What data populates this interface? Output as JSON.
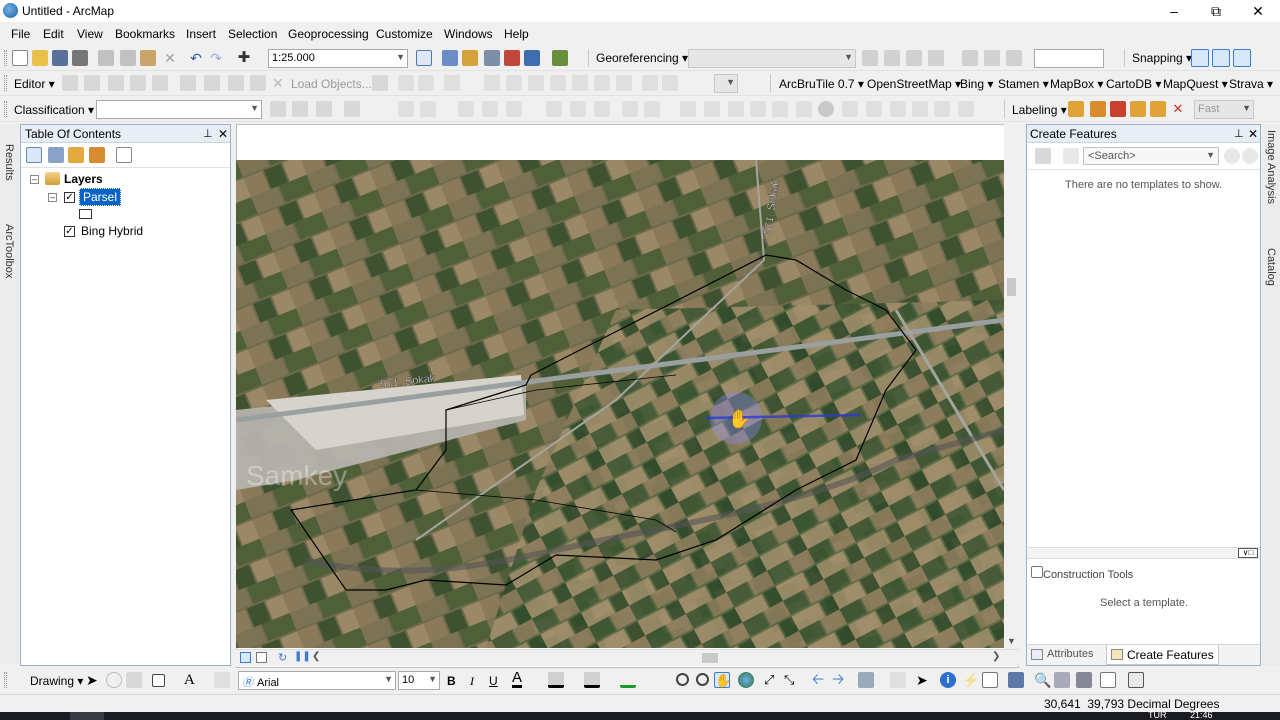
{
  "window": {
    "title": "Untitled - ArcMap"
  },
  "menubar": [
    "File",
    "Edit",
    "View",
    "Bookmarks",
    "Insert",
    "Selection",
    "Geoprocessing",
    "Customize",
    "Windows",
    "Help"
  ],
  "toolbar1": {
    "scale": "1:25.000",
    "georeferencing": "Georeferencing ▾",
    "snapping": "Snapping ▾"
  },
  "toolbar2": {
    "editor": "Editor ▾",
    "load_objects": "Load Objects...",
    "arcbrutile": "ArcBruTile 0.7 ▾",
    "providers": [
      "OpenStreetMap ▾",
      "Bing ▾",
      "Stamen ▾",
      "MapBox ▾",
      "CartoDB ▾",
      "MapQuest ▾",
      "Strava ▾"
    ]
  },
  "toolbar3": {
    "classification": "Classification ▾",
    "labeling": "Labeling ▾",
    "fast": "Fast"
  },
  "toc": {
    "title": "Table Of Contents",
    "root": "Layers",
    "layers": [
      {
        "name": "Parsel"
      },
      {
        "name": "Bing Hybrid"
      }
    ]
  },
  "left_tabs": [
    "Results",
    "ArcToolbox"
  ],
  "right_tabs": [
    "Image Analysis",
    "Catalog"
  ],
  "map_labels": [
    "571. Sokak",
    "571. Sokak",
    "Samkey"
  ],
  "create_features": {
    "title": "Create Features",
    "search_placeholder": "<Search>",
    "empty_message": "There are no templates to show.",
    "construction_title": "Construction Tools",
    "construction_message": "Select a template.",
    "tabs": [
      "Attributes",
      "Create Features"
    ]
  },
  "drawing_toolbar": {
    "drawing": "Drawing ▾",
    "font": "Arial",
    "font_size": "10",
    "bold": "B",
    "italic": "I",
    "underline": "U"
  },
  "statusbar": {
    "coords": "30,641  39,793 Decimal Degrees"
  },
  "taskbar": {
    "lang": "TUR",
    "time": "21:46"
  },
  "colors": {
    "accent": "#0078d7",
    "panel_border": "#9db0c6"
  }
}
